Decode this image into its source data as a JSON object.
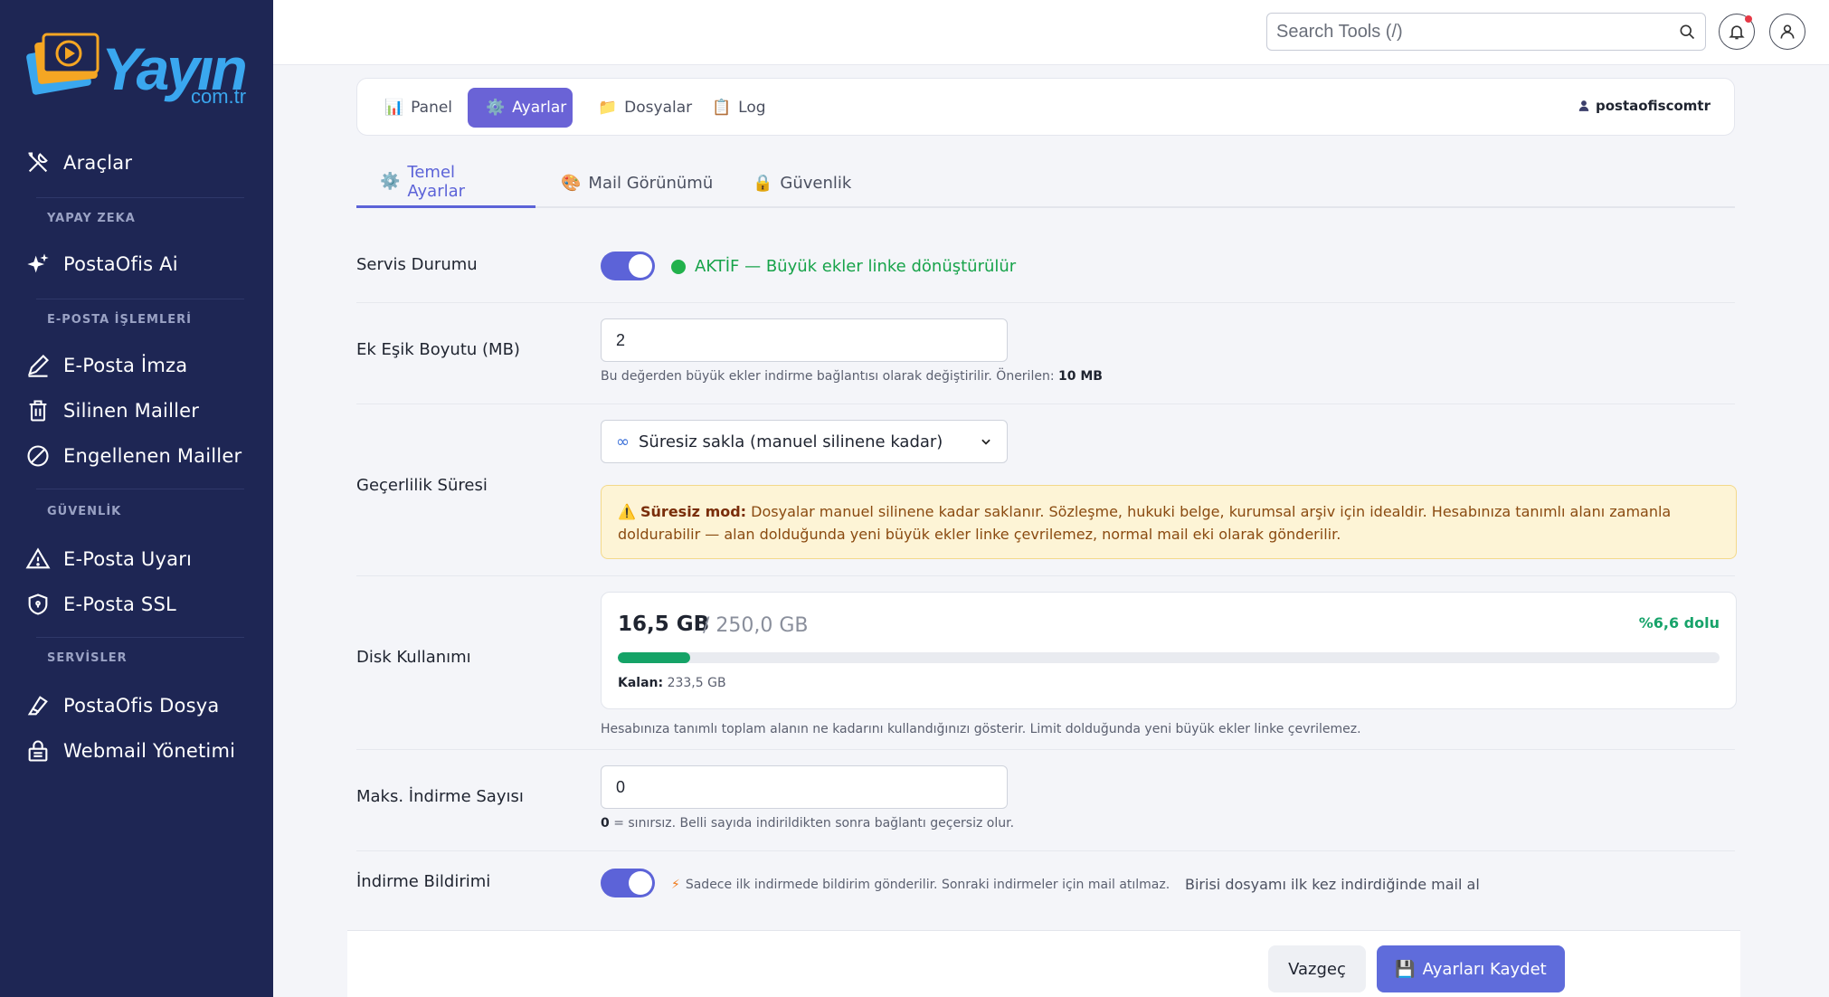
{
  "brand": {
    "name": "Yayın",
    "sub": "com.tr"
  },
  "sidebar": {
    "top_item": {
      "label": "Araçlar",
      "icon": "tools-icon"
    },
    "sections": [
      {
        "title": "YAPAY ZEKA",
        "items": [
          {
            "label": "PostaOfis Ai",
            "icon": "sparkles-icon"
          }
        ]
      },
      {
        "title": "E-POSTA İŞLEMLERİ",
        "items": [
          {
            "label": "E-Posta İmza",
            "icon": "pen-icon"
          },
          {
            "label": "Silinen Mailler",
            "icon": "trash-icon"
          },
          {
            "label": "Engellenen Mailler",
            "icon": "block-icon"
          }
        ]
      },
      {
        "title": "GÜVENLİK",
        "items": [
          {
            "label": "E-Posta Uyarı",
            "icon": "warning-icon"
          },
          {
            "label": "E-Posta SSL",
            "icon": "shield-icon"
          }
        ]
      },
      {
        "title": "SERVİSLER",
        "items": [
          {
            "label": "PostaOfis Dosya",
            "icon": "eraser-icon"
          },
          {
            "label": "Webmail Yönetimi",
            "icon": "lock-icon"
          }
        ]
      }
    ]
  },
  "header": {
    "search_placeholder": "Search Tools (/)"
  },
  "nav": {
    "tabs": [
      {
        "label": "Panel",
        "icon": "📊"
      },
      {
        "label": "Ayarlar",
        "icon": "⚙️"
      },
      {
        "label": "Dosyalar",
        "icon": "📁"
      },
      {
        "label": "Log",
        "icon": "📋"
      }
    ],
    "active": "Ayarlar",
    "user": "postaofiscomtr"
  },
  "subtabs": [
    {
      "label": "Temel Ayarlar",
      "icon": "⚙️"
    },
    {
      "label": "Mail Görünümü",
      "icon": "🎨"
    },
    {
      "label": "Güvenlik",
      "icon": "🔒"
    }
  ],
  "settings": {
    "service": {
      "label": "Servis Durumu",
      "status": "AKTİF — Büyük ekler linke dönüştürülür",
      "enabled": true,
      "status_color": "#17a34a"
    },
    "threshold": {
      "label": "Ek Eşik Boyutu (MB)",
      "value": "2",
      "hint_prefix": "Bu değerden büyük ekler indirme bağlantısı olarak değiştirilir. Önerilen: ",
      "hint_strong": "10 MB"
    },
    "validity": {
      "label": "Geçerlilik Süresi",
      "selected": "Süresiz sakla (manuel silinene kadar)",
      "warning_title": "Süresiz mod:",
      "warning_text": "Dosyalar manuel silinene kadar saklanır. Sözleşme, hukuki belge, kurumsal arşiv için idealdir. Hesabınıza tanımlı alanı zamanla doldurabilir — alan dolduğunda yeni büyük ekler linke çevrilemez, normal mail eki olarak gönderilir."
    },
    "disk": {
      "label": "Disk Kullanımı",
      "used": "16,5 GB",
      "total": "/ 250,0 GB",
      "percent_label": "%6,6 dolu",
      "percent": 6.6,
      "remaining_label": "Kalan:",
      "remaining": "233,5 GB",
      "hint": "Hesabınıza tanımlı toplam alanın ne kadarını kullandığınızı gösterir. Limit dolduğunda yeni büyük ekler linke çevrilemez."
    },
    "max_downloads": {
      "label": "Maks. İndirme Sayısı",
      "value": "0",
      "hint_strong": "0",
      "hint_rest": " = sınırsız. Belli sayıda indirildikten sonra bağlantı geçersiz olur."
    },
    "notify": {
      "label": "İndirme Bildirimi",
      "enabled": true,
      "note": "Sadece ilk indirmede bildirim gönderilir. Sonraki indirmeler için mail atılmaz.",
      "desc": "Birisi dosyamı ilk kez indirdiğinde mail al"
    }
  },
  "actions": {
    "cancel": "Vazgeç",
    "save": "Ayarları Kaydet",
    "save_icon": "💾"
  }
}
